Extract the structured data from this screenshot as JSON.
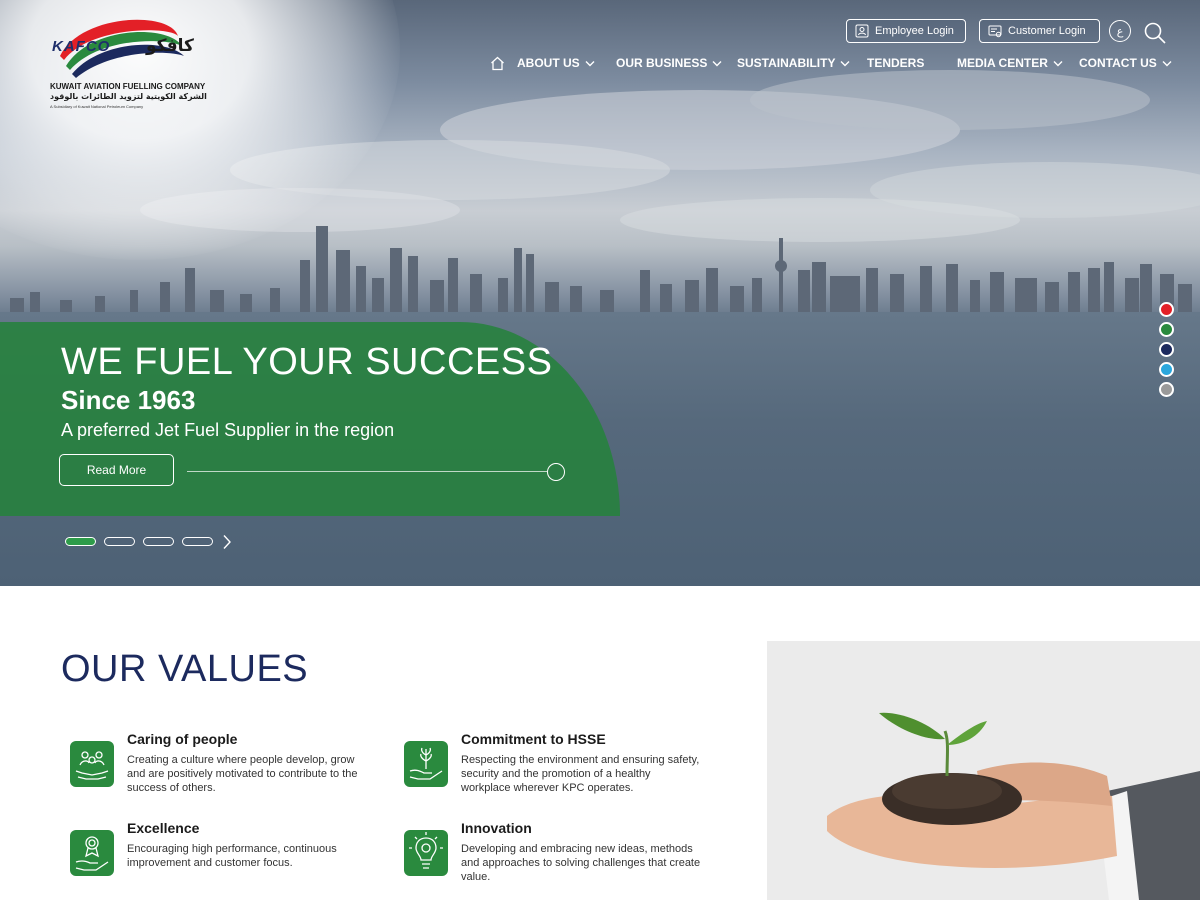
{
  "header": {
    "logo": {
      "name_en": "KAFCO",
      "name_ar": "كافكو",
      "company_en": "KUWAIT AVIATION FUELLING COMPANY",
      "company_ar": "الشركة الكويتية لتزويد الطائرات بالوقود",
      "subsidiary_note": "A Subsidiary of Kuwait National Petroleum Company"
    },
    "employee_login_label": "Employee Login",
    "customer_login_label": "Customer Login",
    "language_toggle": "ع",
    "nav": [
      {
        "label": "ABOUT US"
      },
      {
        "label": "OUR BUSINESS"
      },
      {
        "label": "SUSTAINABILITY"
      },
      {
        "label": "TENDERS"
      },
      {
        "label": "MEDIA CENTER"
      },
      {
        "label": "CONTACT US"
      }
    ]
  },
  "hero": {
    "title": "WE FUEL YOUR SUCCESS",
    "since": "Since 1963",
    "tagline": "A preferred Jet Fuel Supplier in the region",
    "read_more_label": "Read More",
    "slides_total": 4,
    "active_slide": 1,
    "theme_colors": [
      "#e32027",
      "#2a8a3e",
      "#1c2a5e",
      "#2aa7dd",
      "#9a9a9a"
    ]
  },
  "values": {
    "title": "OUR VALUES",
    "items": [
      {
        "title": "Caring of people",
        "description": "Creating a culture where people develop, grow and are positively motivated to contribute to the success of others.",
        "icon": "people-care-icon"
      },
      {
        "title": "Commitment to HSSE",
        "description": "Respecting the environment and ensuring safety, security and the promotion of a healthy workplace wherever KPC operates.",
        "icon": "plant-hand-icon"
      },
      {
        "title": "Excellence",
        "description": "Encouraging high performance, continuous improvement and customer focus.",
        "icon": "award-hand-icon"
      },
      {
        "title": "Innovation",
        "description": "Developing and embracing new ideas, methods and approaches to solving challenges that create value.",
        "icon": "lightbulb-gear-icon"
      }
    ]
  }
}
